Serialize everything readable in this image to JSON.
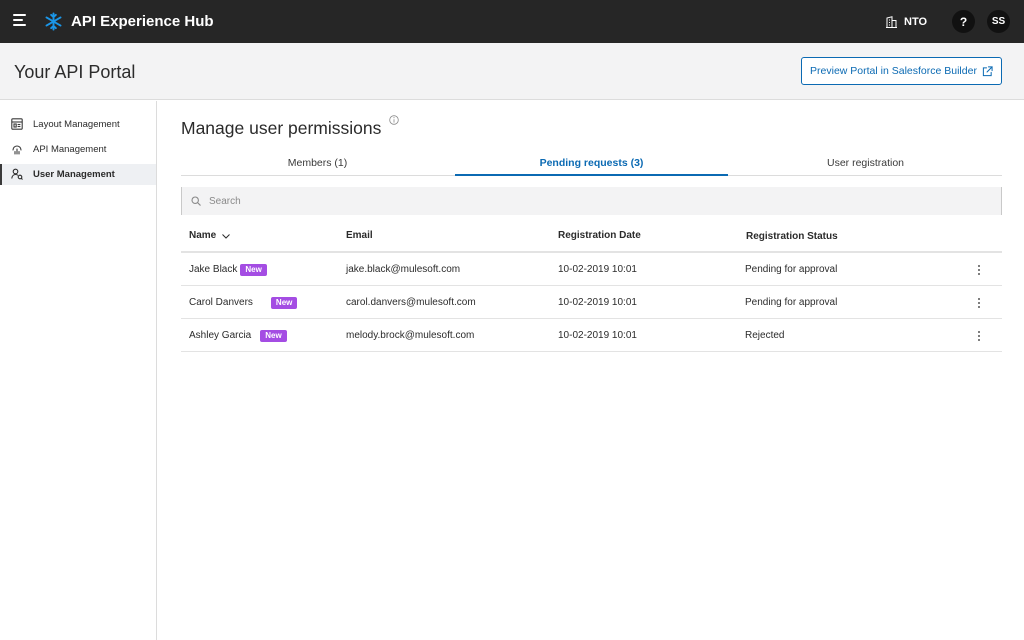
{
  "app": {
    "title": "API Experience Hub",
    "org": "NTO",
    "help": "?",
    "user_initials": "SS"
  },
  "header": {
    "title": "Your API Portal",
    "preview_button": "Preview Portal in Salesforce Builder"
  },
  "sidebar": {
    "items": [
      {
        "label": "Layout Management",
        "icon": "layout-icon",
        "active": false
      },
      {
        "label": "API Management",
        "icon": "api-icon",
        "active": false
      },
      {
        "label": "User Management",
        "icon": "users-icon",
        "active": true
      }
    ]
  },
  "main": {
    "title": "Manage user permissions",
    "tabs": [
      {
        "label": "Members  (1)",
        "active": false
      },
      {
        "label": "Pending requests  (3)",
        "active": true
      },
      {
        "label": "User registration",
        "active": false
      }
    ],
    "search": {
      "placeholder": "Search",
      "value": ""
    },
    "columns": [
      "Name",
      "Email",
      "Registration Date",
      "Registration Status"
    ],
    "rows": [
      {
        "name": "Jake Black",
        "badge": "New",
        "email": "jake.black@mulesoft.com",
        "date": "10-02-2019 10:01",
        "status": "Pending for approval"
      },
      {
        "name": "Carol Danvers",
        "badge": "New",
        "email": "carol.danvers@mulesoft.com",
        "date": "10-02-2019 10:01",
        "status": "Pending for approval"
      },
      {
        "name": "Ashley Garcia",
        "badge": "New",
        "email": "melody.brock@mulesoft.com",
        "date": "10-02-2019 10:01",
        "status": "Rejected"
      }
    ]
  },
  "colors": {
    "topbar": "#262626",
    "accent": "#0b6ab3",
    "badge": "#a44de3",
    "logo": "#1b96e8"
  }
}
